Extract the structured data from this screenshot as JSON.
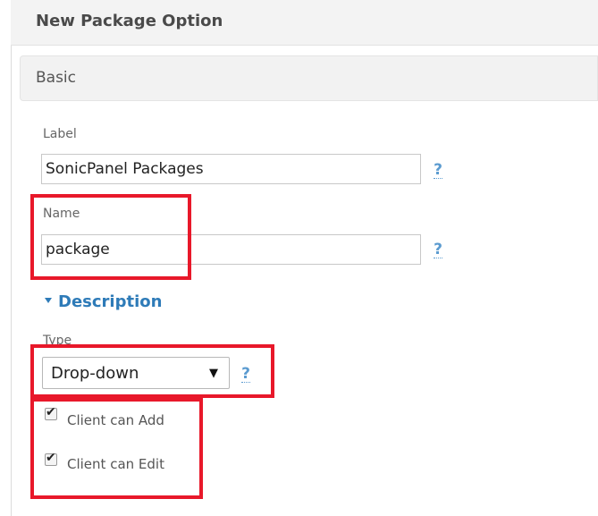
{
  "header": {
    "title": "New Package Option"
  },
  "section": {
    "title": "Basic"
  },
  "fields": {
    "label": {
      "label": "Label",
      "value": "SonicPanel Packages",
      "help": "?"
    },
    "name": {
      "label": "Name",
      "value": "package",
      "help": "?"
    }
  },
  "description_toggle": {
    "label": "Description"
  },
  "type": {
    "label": "Type",
    "selected": "Drop-down",
    "arrow": "▼",
    "help": "?"
  },
  "checkboxes": [
    {
      "label": "Client can Add",
      "checked": true,
      "mark": "✔"
    },
    {
      "label": "Client can Edit",
      "checked": true,
      "mark": "✔"
    }
  ],
  "colors": {
    "highlight": "#e8182a",
    "link": "#2e7bb8",
    "help": "#5b9bd0"
  }
}
